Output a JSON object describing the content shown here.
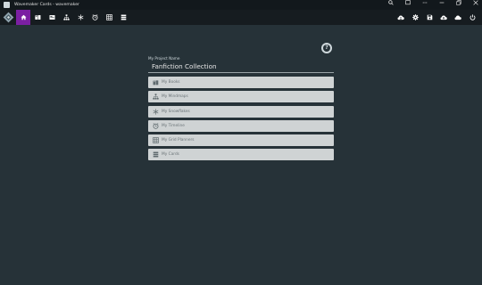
{
  "window": {
    "title": "Wavemaker Cards - wavemaker",
    "controls": [
      "search-icon",
      "screen-icon",
      "more-icon",
      "minimize-icon",
      "restore-icon",
      "close-icon"
    ]
  },
  "toolbar": {
    "left_buttons": [
      {
        "name": "home",
        "icon": "home-icon",
        "active": true
      },
      {
        "name": "books",
        "icon": "books-icon"
      },
      {
        "name": "cards",
        "icon": "card-icon"
      },
      {
        "name": "snowflake",
        "icon": "snowflake-icon"
      },
      {
        "name": "mindmaps",
        "icon": "mindmap-icon"
      },
      {
        "name": "timeline",
        "icon": "clock-icon"
      },
      {
        "name": "grid",
        "icon": "grid-icon"
      },
      {
        "name": "stack",
        "icon": "stack-icon"
      }
    ],
    "right_buttons": [
      {
        "name": "cloud-account",
        "icon": "cloud-user-icon"
      },
      {
        "name": "settings",
        "icon": "gear-icon"
      },
      {
        "name": "save",
        "icon": "save-icon"
      },
      {
        "name": "cloud-upload",
        "icon": "cloud-upload-icon"
      },
      {
        "name": "cloud-sync",
        "icon": "cloud-sync-icon"
      },
      {
        "name": "power",
        "icon": "power-icon"
      }
    ],
    "accent": "#7b1fa2"
  },
  "help": {
    "icon": "help-icon",
    "glyph": "?"
  },
  "project": {
    "label": "My Project Name",
    "name": "Fanfiction Collection"
  },
  "items": [
    {
      "label": "My Books",
      "icon": "books-icon"
    },
    {
      "label": "My Mindmaps",
      "icon": "mindmap-icon"
    },
    {
      "label": "My Snowflakes",
      "icon": "snowflake-icon"
    },
    {
      "label": "My Timeline",
      "icon": "clock-icon"
    },
    {
      "label": "My Grid Planners",
      "icon": "grid-icon"
    },
    {
      "label": "My Cards",
      "icon": "stack-icon"
    }
  ]
}
